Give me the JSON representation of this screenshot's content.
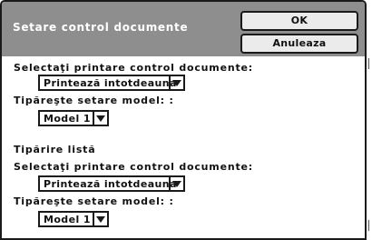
{
  "dialog": {
    "title": "Setare control documente",
    "ok_label": "OK",
    "cancel_label": "Anuleaza"
  },
  "section1": {
    "select_label": "Selectaţi printare control documente:",
    "mode_value": "Printează intotdeauna",
    "model_label": "Tipăreşte setare model: :",
    "model_value": "Model 1"
  },
  "section2": {
    "heading": "Tipărire listă",
    "select_label": "Selectaţi printare control documente:",
    "mode_value": "Printează intotdeauna",
    "model_label": "Tipăreşte setare model: :",
    "model_value": "Model 1"
  }
}
